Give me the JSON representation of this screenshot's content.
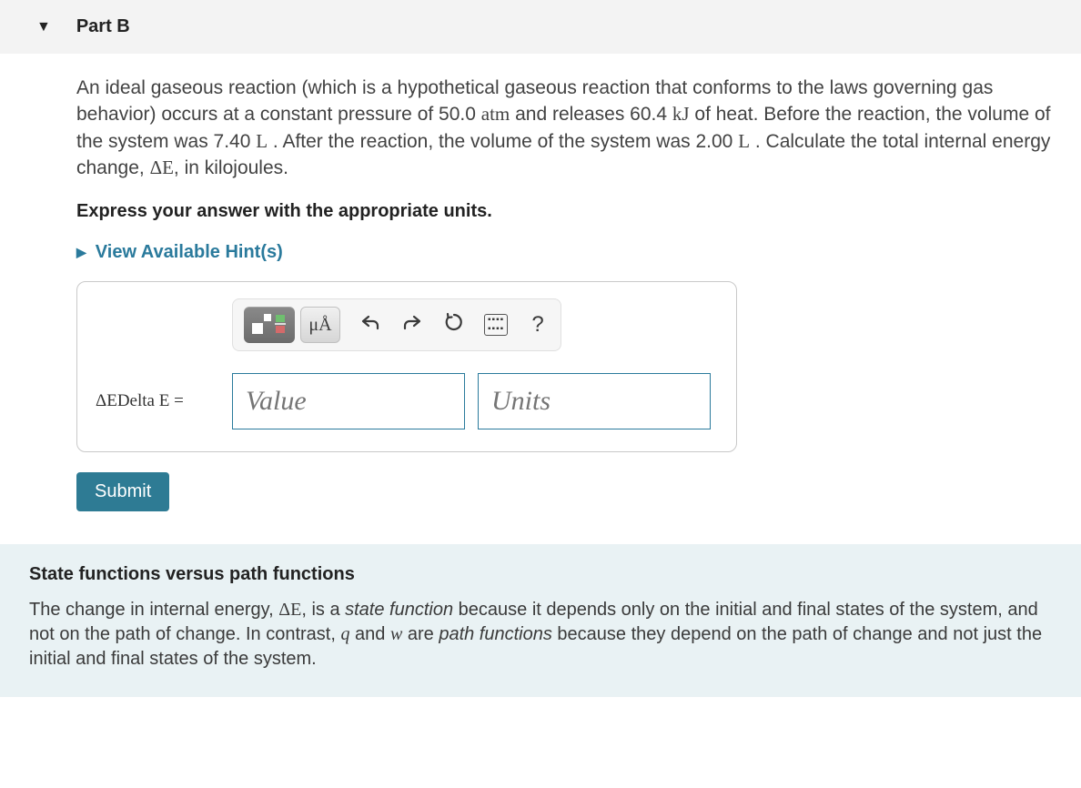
{
  "part": {
    "label": "Part B"
  },
  "problem": {
    "seg1": "An ideal gaseous reaction (which is a hypothetical gaseous reaction that conforms to the laws governing gas behavior) occurs at a constant pressure of 50.0 ",
    "unit1": "atm",
    "seg2": " and releases 60.4 ",
    "unit2": "kJ",
    "seg3": " of heat. Before the reaction, the volume of the system was 7.40 ",
    "unit3": "L",
    "seg4": " . After the reaction, the volume of the system was 2.00 ",
    "unit4": "L",
    "seg5": " . Calculate the total internal energy change, ",
    "deltaE": "ΔE",
    "seg6": ", in kilojoules."
  },
  "instruction": "Express your answer with the appropriate units.",
  "hints_label": "View Available Hint(s)",
  "toolbar": {
    "units_btn": "μÅ"
  },
  "answer": {
    "lhs": "ΔEDelta E =",
    "value_placeholder": "Value",
    "units_placeholder": "Units"
  },
  "submit_label": "Submit",
  "info": {
    "title": "State functions versus path functions",
    "seg1": "The change in internal energy, ",
    "deltaE": "ΔE",
    "seg2": ", is a ",
    "sf": "state function",
    "seg3": " because it depends only on the initial and final states of the system, and not on the path of change. In contrast, ",
    "q": "q",
    "seg4": " and ",
    "w": "w",
    "seg5": " are ",
    "pf": "path functions",
    "seg6": " because they depend on the path of change and not just the initial and final states of the system."
  }
}
